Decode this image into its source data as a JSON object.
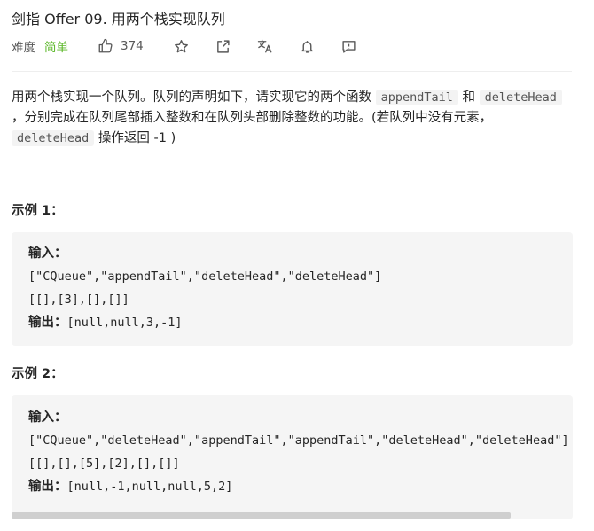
{
  "problem": {
    "title": "剑指 Offer 09. 用两个栈实现队列",
    "difficulty_label": "难度",
    "difficulty_value": "简单",
    "likes": "374",
    "difficulty_color": "#5ab726"
  },
  "toolbar_icons": [
    "thumbs-up-icon",
    "star-icon",
    "share-icon",
    "translate-icon",
    "bell-icon",
    "feedback-icon"
  ],
  "description": {
    "part1": "用两个栈实现一个队列。队列的声明如下，请实现它的两个函数 ",
    "code1": "appendTail",
    "part2": " 和 ",
    "code2": "deleteHead",
    "part3": " ，分别完成在队列尾部插入整数和在队列头部删除整数的功能。(若队列中没有元素，",
    "code3": "deleteHead",
    "part4": " 操作返回 -1 )"
  },
  "examples": [
    {
      "title": "示例 1：",
      "input_label": "输入：",
      "input_line1": "[\"CQueue\",\"appendTail\",\"deleteHead\",\"deleteHead\"]",
      "input_line2": "[[],[3],[],[]]",
      "output_label": "输出：",
      "output_value": "[null,null,3,-1]"
    },
    {
      "title": "示例 2：",
      "input_label": "输入：",
      "input_line1": "[\"CQueue\",\"deleteHead\",\"appendTail\",\"appendTail\",\"deleteHead\",\"deleteHead\"]",
      "input_line2": "[[],[],[5],[2],[],[]]",
      "output_label": "输出：",
      "output_value": "[null,-1,null,null,5,2]"
    }
  ]
}
